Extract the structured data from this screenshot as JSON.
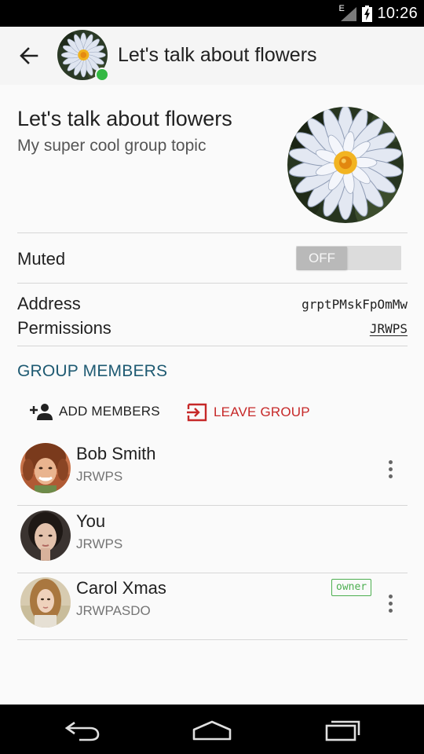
{
  "status_bar": {
    "network_type": "E",
    "time": "10:26",
    "icons": [
      "signal-icon",
      "battery-charging-icon"
    ]
  },
  "app_bar": {
    "title": "Let's talk about flowers",
    "back_icon": "arrow-left-icon",
    "online": true
  },
  "group": {
    "name": "Let's talk about flowers",
    "topic": "My super cool group topic"
  },
  "settings": {
    "muted_label": "Muted",
    "muted_toggle_text": "OFF",
    "muted": false,
    "address_label": "Address",
    "address_value": "grptPMskFpOmMw",
    "permissions_label": "Permissions",
    "permissions_value": "JRWPS"
  },
  "members_section": {
    "title": "GROUP MEMBERS",
    "add_label": "ADD MEMBERS",
    "leave_label": "LEAVE GROUP"
  },
  "members": [
    {
      "name": "Bob Smith",
      "permissions": "JRWPS",
      "badge": "",
      "has_menu": true
    },
    {
      "name": "You",
      "permissions": "JRWPS",
      "badge": "",
      "has_menu": false
    },
    {
      "name": "Carol Xmas",
      "permissions": "JRWPASDO",
      "badge": "owner",
      "has_menu": true
    }
  ],
  "colors": {
    "accent": "#1e5a72",
    "danger": "#c62828",
    "online": "#33b843",
    "owner_badge": "#4caf50"
  }
}
